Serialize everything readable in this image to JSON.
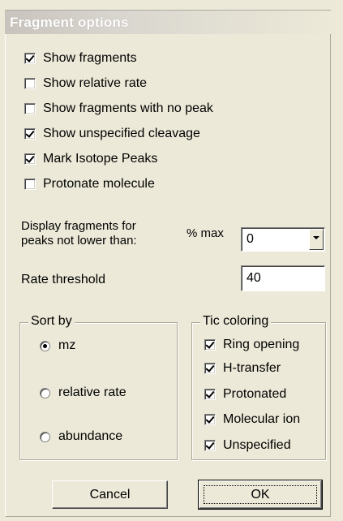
{
  "dialog": {
    "title": "Fragment options"
  },
  "options": [
    {
      "label": "Show fragments",
      "checked": true
    },
    {
      "label": "Show relative rate",
      "checked": false
    },
    {
      "label": "Show fragments with no peak",
      "checked": false
    },
    {
      "label": "Show unspecified cleavage",
      "checked": true
    },
    {
      "label": "Mark Isotope Peaks",
      "checked": true
    },
    {
      "label": "Protonate molecule",
      "checked": false
    }
  ],
  "display": {
    "label_line1": "Display fragments for",
    "label_line2": "peaks not lower than:",
    "unit": "% max",
    "value": "0"
  },
  "rate_threshold": {
    "label": "Rate threshold",
    "value": "40"
  },
  "sort_by": {
    "title": "Sort by",
    "options": [
      {
        "label": "mz",
        "selected": true
      },
      {
        "label": "relative rate",
        "selected": false
      },
      {
        "label": "abundance",
        "selected": false
      }
    ]
  },
  "tic_coloring": {
    "title": "Tic coloring",
    "options": [
      {
        "label": "Ring opening",
        "checked": true
      },
      {
        "label": "H-transfer",
        "checked": true
      },
      {
        "label": "Protonated",
        "checked": true
      },
      {
        "label": "Molecular ion",
        "checked": true
      },
      {
        "label": "Unspecified",
        "checked": true
      }
    ]
  },
  "buttons": {
    "cancel": "Cancel",
    "ok": "OK"
  }
}
